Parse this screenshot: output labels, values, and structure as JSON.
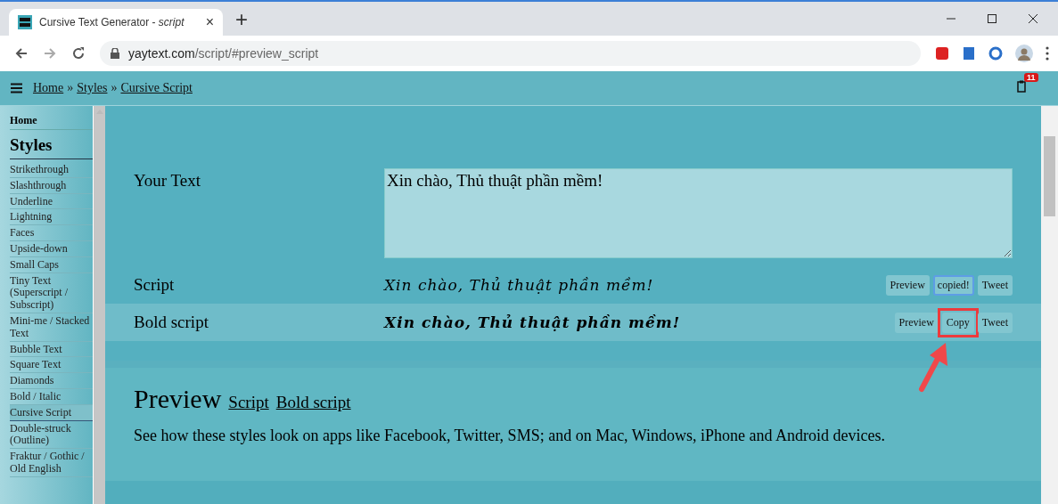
{
  "browser": {
    "tab": {
      "title": "Cursive Text Generator - *script*",
      "close": "×"
    },
    "new_tab": "+",
    "address": {
      "host": "yaytext.com",
      "path": "/script/#preview_script"
    }
  },
  "header": {
    "breadcrumbs": [
      {
        "kind": "link",
        "label": "Home"
      },
      {
        "kind": "sep",
        "label": "»"
      },
      {
        "kind": "link",
        "label": "Styles"
      },
      {
        "kind": "sep",
        "label": "»"
      },
      {
        "kind": "link",
        "label": "Cursive Script"
      }
    ],
    "clipboard_count": "11"
  },
  "sidebar": {
    "home": "Home",
    "heading": "Styles",
    "items": [
      {
        "label": "Strikethrough",
        "selected": false
      },
      {
        "label": "Slashthrough",
        "selected": false
      },
      {
        "label": "Underline",
        "selected": false
      },
      {
        "label": "Lightning",
        "selected": false
      },
      {
        "label": "Faces",
        "selected": false
      },
      {
        "label": "Upside-down",
        "selected": false
      },
      {
        "label": "Small Caps",
        "selected": false
      },
      {
        "label": "Tiny Text (Superscript / Subscript)",
        "selected": false
      },
      {
        "label": "Mini-me / Stacked Text",
        "selected": false
      },
      {
        "label": "Bubble Text",
        "selected": false
      },
      {
        "label": "Square Text",
        "selected": false
      },
      {
        "label": "Diamonds",
        "selected": false
      },
      {
        "label": "Bold / Italic",
        "selected": false
      },
      {
        "label": "Cursive Script",
        "selected": true
      },
      {
        "label": "Double-struck (Outline)",
        "selected": false
      },
      {
        "label": "Fraktur / Gothic / Old English",
        "selected": false
      }
    ]
  },
  "input": {
    "label": "Your Text",
    "value": "Xin chào, Thủ thuật phần mềm!"
  },
  "results": [
    {
      "kind": "script",
      "label": "Script",
      "text": "Xin chào, Thủ thuật phần mềm!",
      "buttons": [
        {
          "label": "Preview",
          "focused": false,
          "marked": false
        },
        {
          "label": "copied!",
          "focused": true,
          "marked": false
        },
        {
          "label": "Tweet",
          "focused": false,
          "marked": false
        }
      ]
    },
    {
      "kind": "bold",
      "label": "Bold script",
      "text": "Xin chào, Thủ thuật phần mềm!",
      "buttons": [
        {
          "label": "Preview",
          "focused": false,
          "marked": false
        },
        {
          "label": "Copy",
          "focused": false,
          "marked": true
        },
        {
          "label": "Tweet",
          "focused": false,
          "marked": false
        }
      ]
    }
  ],
  "preview": {
    "title": "Preview",
    "links": [
      "Script",
      "Bold script"
    ],
    "text": "See how these styles look on apps like Facebook, Twitter, SMS; and on Mac, Windows, iPhone and Android devices."
  }
}
